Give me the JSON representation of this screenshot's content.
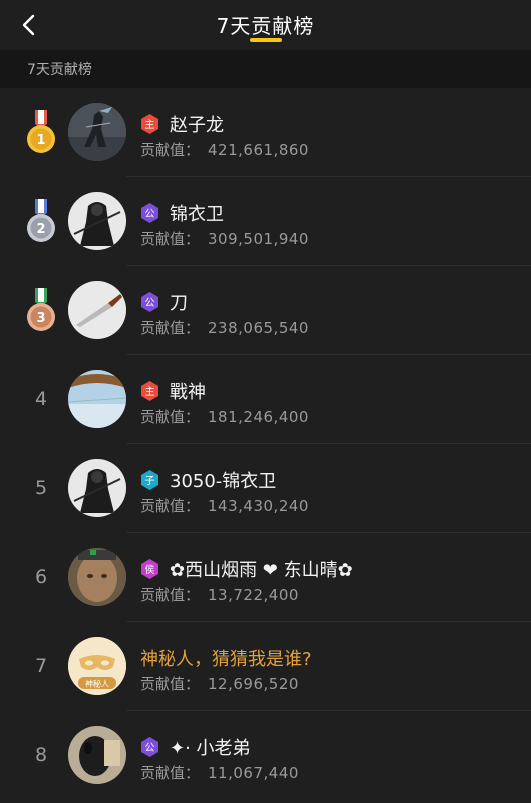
{
  "header": {
    "title": "7天贡献榜",
    "back_icon": "chevron-left-icon"
  },
  "section": {
    "label": "7天贡献榜"
  },
  "colors": {
    "accent": "#f5c518",
    "mystery_name": "#e2a13a"
  },
  "score_label": "贡献值：",
  "ranking": [
    {
      "rank": "1",
      "medal": "gold-medal-icon",
      "badge": "主",
      "badge_color": "#e74c3c",
      "name": "赵子龙",
      "score": "421,661,860"
    },
    {
      "rank": "2",
      "medal": "silver-medal-icon",
      "badge": "公",
      "badge_color": "#7b4fd9",
      "name": "锦衣卫",
      "score": "309,501,940"
    },
    {
      "rank": "3",
      "medal": "bronze-medal-icon",
      "badge": "公",
      "badge_color": "#7b4fd9",
      "name": "刀",
      "score": "238,065,540"
    },
    {
      "rank": "4",
      "badge": "主",
      "badge_color": "#e74c3c",
      "name": "戰神",
      "score": "181,246,400"
    },
    {
      "rank": "5",
      "badge": "子",
      "badge_color": "#1fa9c9",
      "name": "3050-锦衣卫",
      "score": "143,430,240"
    },
    {
      "rank": "6",
      "badge": "侯",
      "badge_color": "#c23ec9",
      "name": "✿西山烟雨 ❤ 东山晴✿",
      "score": "13,722,400"
    },
    {
      "rank": "7",
      "name": "神秘人，猜猜我是谁?",
      "score": "12,696,520",
      "avatar_caption": "神秘人"
    },
    {
      "rank": "8",
      "badge": "公",
      "badge_color": "#7b4fd9",
      "name": "✦· 小老弟",
      "score": "11,067,440"
    }
  ]
}
